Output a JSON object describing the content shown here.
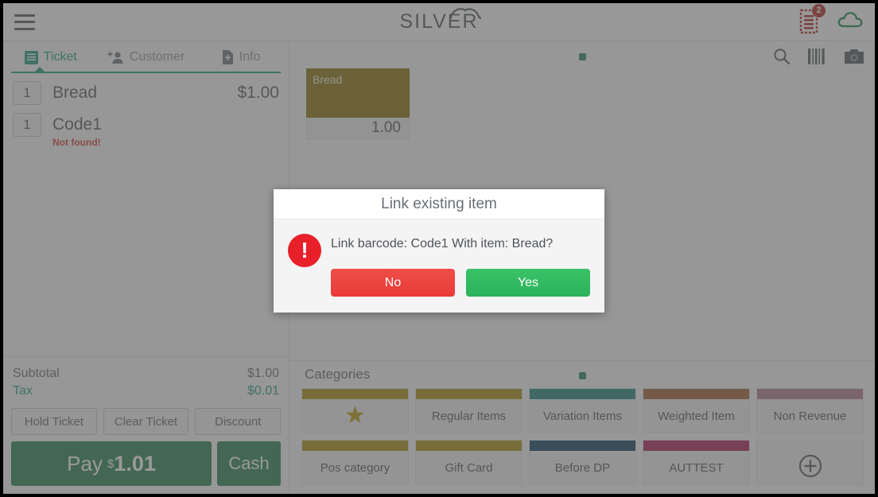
{
  "app": {
    "brand": "SILVER",
    "menu_icon": "hamburger-icon",
    "receipt_badge": "2"
  },
  "left_panel": {
    "tabs": [
      {
        "label": "Ticket",
        "icon": "list-icon",
        "active": true
      },
      {
        "label": "Customer",
        "icon": "add-person-icon",
        "active": false
      },
      {
        "label": "Info",
        "icon": "file-add-icon",
        "active": false
      }
    ],
    "ticket_items": [
      {
        "qty": "1",
        "name": "Bread",
        "price": "$1.00",
        "note": ""
      },
      {
        "qty": "1",
        "name": "Code1",
        "price": "",
        "note": "Not found!"
      }
    ],
    "totals": [
      {
        "label": "Subtotal",
        "value": "$1.00"
      },
      {
        "label": "Tax",
        "value": "$0.01"
      }
    ],
    "actions": [
      "Hold Ticket",
      "Clear Ticket",
      "Discount"
    ],
    "pay": {
      "label": "Pay",
      "currency": "$",
      "amount": "1.01"
    },
    "cash": "Cash"
  },
  "main_panel": {
    "toolbar_icons": [
      "search-icon",
      "barcode-icon",
      "camera-icon"
    ],
    "items": [
      {
        "name": "Bread",
        "price": "1.00",
        "color": "#8a7005"
      }
    ],
    "categories_title": "Categories",
    "categories": [
      {
        "label": "",
        "color": "#a88c06",
        "icon": "star-icon"
      },
      {
        "label": "Regular Items",
        "color": "#a88c06",
        "icon": ""
      },
      {
        "label": "Variation Items",
        "color": "#167f79",
        "icon": ""
      },
      {
        "label": "Weighted Item",
        "color": "#a15a29",
        "icon": ""
      },
      {
        "label": "Non Revenue",
        "color": "#b0788c",
        "icon": ""
      },
      {
        "label": "Pos category",
        "color": "#a88c06",
        "icon": ""
      },
      {
        "label": "Gift Card",
        "color": "#a88c06",
        "icon": ""
      },
      {
        "label": "Before DP",
        "color": "#03395e",
        "icon": ""
      },
      {
        "label": "AUTTEST",
        "color": "#a81551",
        "icon": ""
      },
      {
        "label": "",
        "color": "",
        "icon": "plus-circle-icon"
      }
    ]
  },
  "dialog": {
    "title": "Link existing item",
    "message": "Link barcode: Code1 With item: Bread?",
    "alert_icon": "exclamation-icon",
    "buttons": {
      "no": "No",
      "yes": "Yes"
    }
  },
  "colors": {
    "accent_teal": "#17957c",
    "pay_green": "#1e7b46",
    "danger_red": "#e8202a",
    "yes_green": "#2bb25b"
  }
}
